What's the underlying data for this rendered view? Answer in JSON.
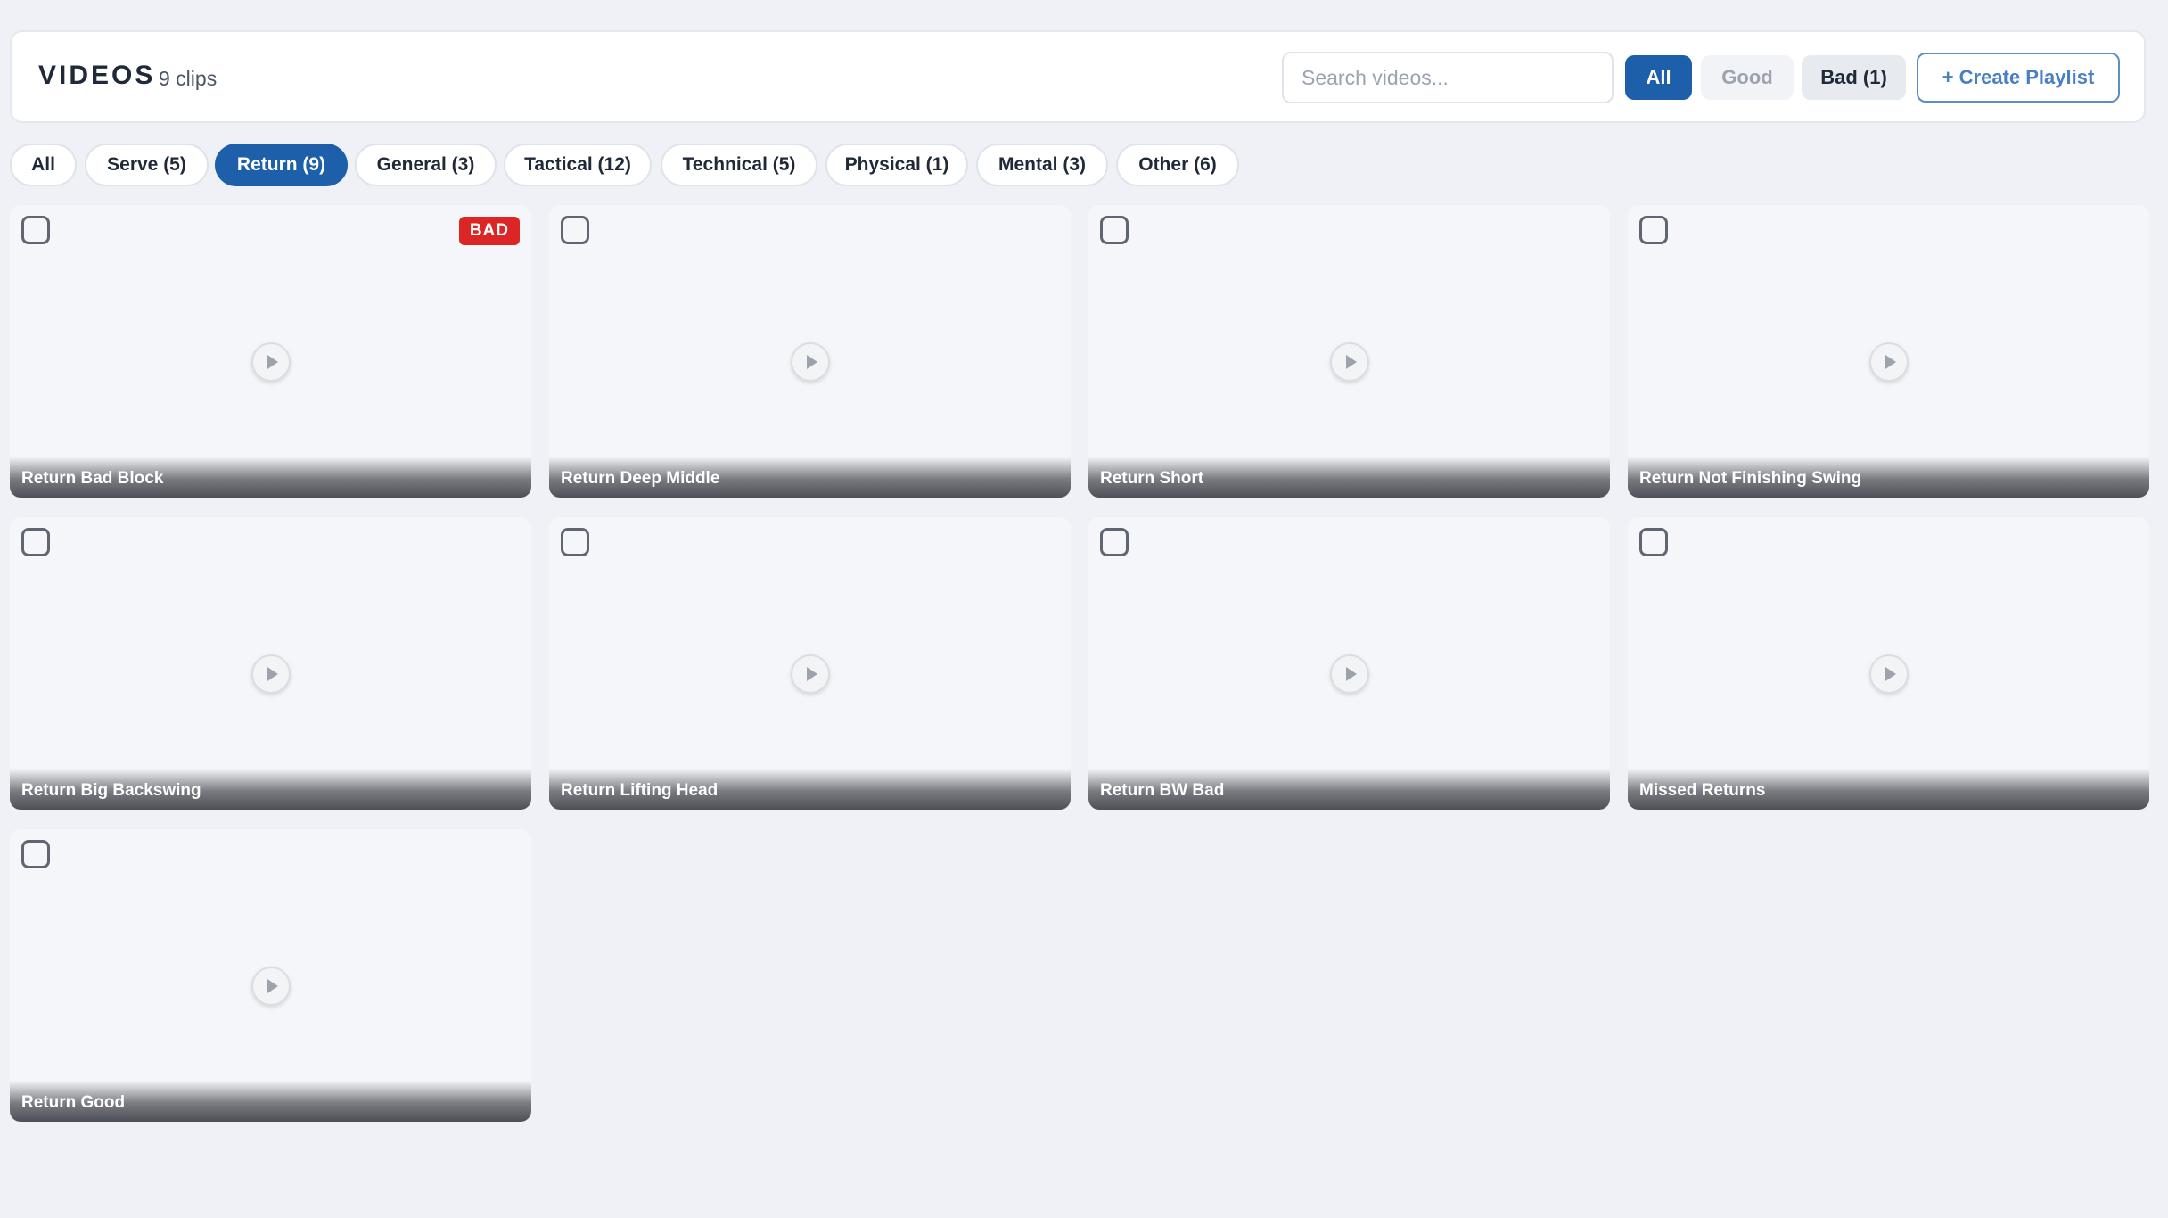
{
  "header": {
    "title": "VIDEOS",
    "clip_count": "9 clips",
    "search_placeholder": "Search videos...",
    "filters": {
      "all": "All",
      "good": "Good",
      "bad": "Bad (1)"
    },
    "create_playlist": "+ Create Playlist"
  },
  "categories": [
    {
      "label": "All",
      "active": false
    },
    {
      "label": "Serve (5)",
      "active": false
    },
    {
      "label": "Return (9)",
      "active": true
    },
    {
      "label": "General (3)",
      "active": false
    },
    {
      "label": "Tactical (12)",
      "active": false
    },
    {
      "label": "Technical (5)",
      "active": false
    },
    {
      "label": "Physical (1)",
      "active": false
    },
    {
      "label": "Mental (3)",
      "active": false
    },
    {
      "label": "Other (6)",
      "active": false
    }
  ],
  "colors": {
    "accent": "#1d5fa8",
    "bad": "#dc2626",
    "background": "#eff1f6"
  },
  "videos": [
    {
      "title": "Return Bad Block",
      "badge": "BAD"
    },
    {
      "title": "Return Deep Middle",
      "badge": ""
    },
    {
      "title": "Return Short",
      "badge": ""
    },
    {
      "title": "Return Not Finishing Swing",
      "badge": ""
    },
    {
      "title": "Return Big Backswing",
      "badge": ""
    },
    {
      "title": "Return Lifting Head",
      "badge": ""
    },
    {
      "title": "Return BW Bad",
      "badge": ""
    },
    {
      "title": "Missed Returns",
      "badge": ""
    },
    {
      "title": "Return Good",
      "badge": ""
    }
  ]
}
